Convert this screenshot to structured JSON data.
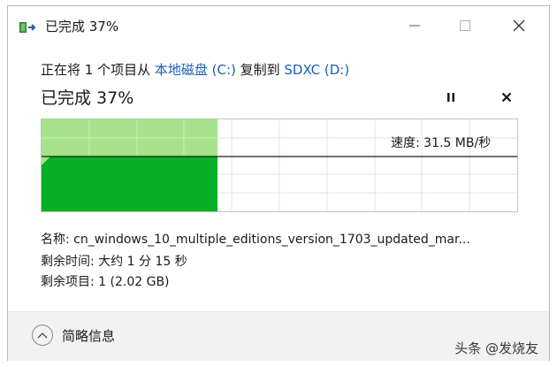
{
  "window": {
    "title": "已完成 37%",
    "app_icon": "copy-progress-icon",
    "controls": {
      "minimize_icon": "minimize-icon",
      "maximize_icon": "maximize-icon",
      "close_icon": "close-icon"
    }
  },
  "transfer": {
    "prefix": "正在将 1 个项目从 ",
    "source": "本地磁盘 (C:)",
    "middle": " 复制到 ",
    "destination": "SDXC (D:)",
    "status": "已完成 37%",
    "progress_percent": 37,
    "pause_icon": "pause-icon",
    "cancel_icon": "cancel-icon"
  },
  "graph": {
    "speed_label": "速度: 31.5 MB/秒",
    "colors": {
      "done_fill": "#06b025",
      "history_fill": "#a6e28c",
      "grid": "#d4ecd4",
      "speed_line": "#1a1a1a"
    }
  },
  "details": {
    "name_label": "名称: cn_windows_10_multiple_editions_version_1703_updated_mar...",
    "time_label": "剩余时间: 大约 1 分 15 秒",
    "items_label": "剩余项目: 1 (2.02 GB)"
  },
  "footer": {
    "toggle_label": "简略信息",
    "toggle_icon": "chevron-up-icon",
    "watermark": "头条 @发烧友"
  },
  "colors": {
    "link": "#1a5fb4",
    "footer_bg": "#f2f2f2"
  }
}
